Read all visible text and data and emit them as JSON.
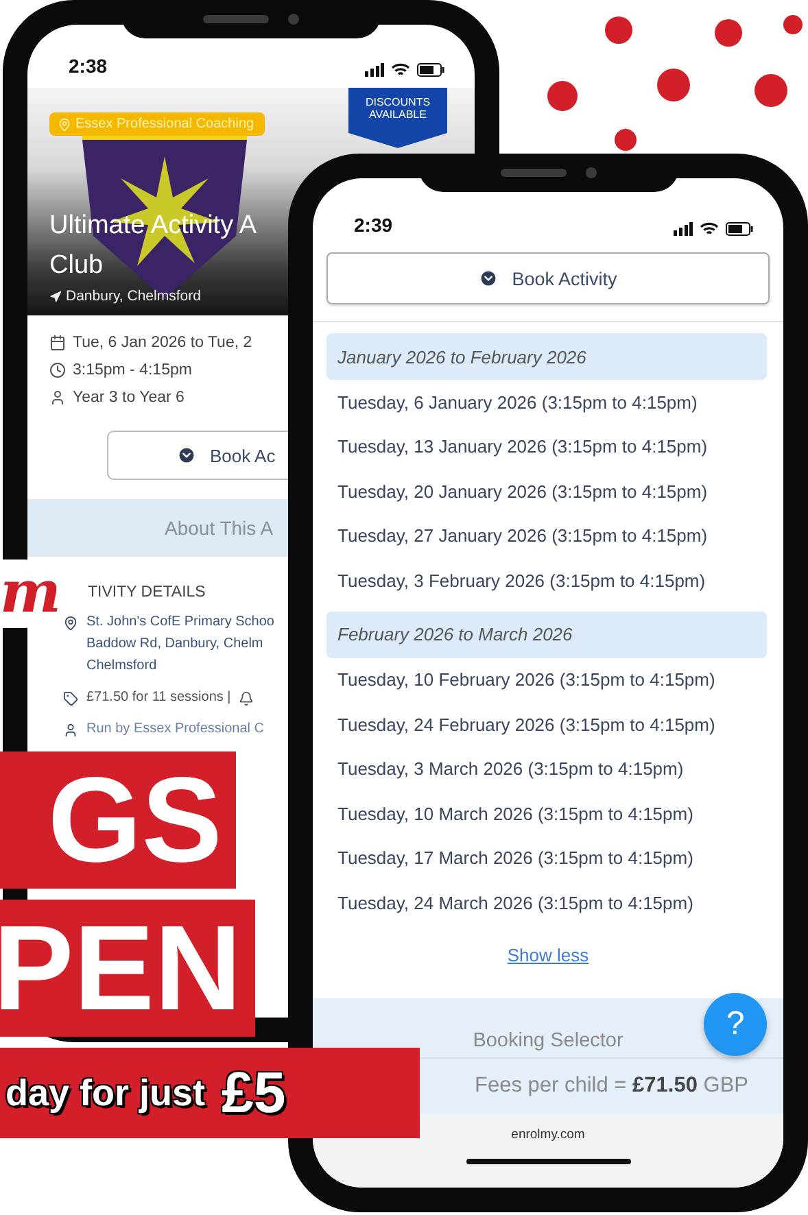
{
  "background_phone": {
    "time": "2:38",
    "provider_badge": "Essex Professional Coaching",
    "discount_ribbon": "DISCOUNTS AVAILABLE",
    "title_lines": [
      "Ultimate Activity A",
      "Club"
    ],
    "location": "Danbury, Chelmsford",
    "details": [
      {
        "kind": "date",
        "text": "Tue, 6 Jan 2026 to Tue, 2"
      },
      {
        "kind": "time",
        "text": "3:15pm - 4:15pm"
      },
      {
        "kind": "year",
        "text": "Year 3 to Year 6"
      }
    ],
    "book_button": "Book Ac",
    "about_tab": "About This A",
    "section_heading": "TIVITY DETAILS",
    "activity_details": [
      {
        "kind": "location",
        "lines": [
          "St. John's CofE Primary Schoo",
          "Baddow Rd, Danbury, Chelm",
          "Chelmsford"
        ]
      },
      {
        "kind": "price",
        "lines": [
          "£71.50 for 11 sessions |"
        ]
      },
      {
        "kind": "organiser",
        "lines": [
          "Run by Essex Professional C"
        ]
      }
    ]
  },
  "front_phone": {
    "time": "2:39",
    "book_button": "Book Activity",
    "session_groups": [
      {
        "heading": "January 2026 to February 2026",
        "sessions": [
          "Tuesday, 6 January 2026 (3:15pm to 4:15pm)",
          "Tuesday, 13 January 2026 (3:15pm to 4:15pm)",
          "Tuesday, 20 January 2026 (3:15pm to 4:15pm)",
          "Tuesday, 27 January 2026 (3:15pm to 4:15pm)",
          "Tuesday, 3 February 2026 (3:15pm to 4:15pm)"
        ]
      },
      {
        "heading": "February 2026 to March 2026",
        "sessions": [
          "Tuesday, 10 February 2026 (3:15pm to 4:15pm)",
          "Tuesday, 24 February 2026 (3:15pm to 4:15pm)",
          "Tuesday, 3 March 2026 (3:15pm to 4:15pm)",
          "Tuesday, 10 March 2026 (3:15pm to 4:15pm)",
          "Tuesday, 17 March 2026 (3:15pm to 4:15pm)",
          "Tuesday, 24 March 2026 (3:15pm to 4:15pm)"
        ]
      }
    ],
    "show_less_link": "Show less",
    "help_button": "?",
    "booking_selector": "Booking Selector",
    "fees": "Fees per child = **£71.50** GBP",
    "footer_url": "enrolmy.com"
  },
  "poster": {
    "sticker": "m",
    "headline_lines": [
      "GS",
      "PEN"
    ],
    "offer": "day for just",
    "price": "£5"
  }
}
